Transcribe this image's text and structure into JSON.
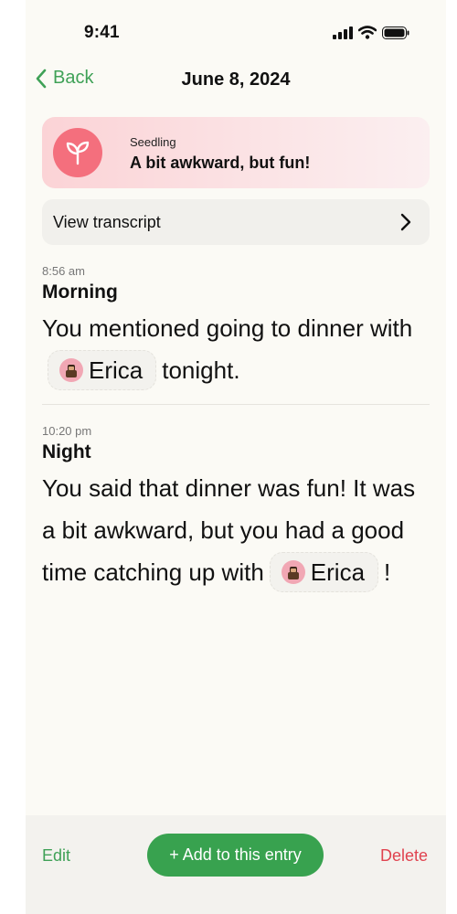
{
  "status_bar": {
    "time": "9:41",
    "icons": [
      "cellular-signal-icon",
      "wifi-icon",
      "battery-icon"
    ]
  },
  "nav": {
    "back_label": "Back",
    "title": "June 8, 2024"
  },
  "mood": {
    "kicker": "Seedling",
    "summary": "A bit awkward, but fun!",
    "icon": "sprout-icon"
  },
  "transcript": {
    "label": "View transcript"
  },
  "entries": [
    {
      "time": "8:56 am",
      "label": "Morning",
      "text_before": "You mentioned going to dinner with",
      "mention": "Erica",
      "text_after": "tonight."
    },
    {
      "time": "10:20 pm",
      "label": "Night",
      "text_before": "You said that dinner was fun! It was a bit awkward, but you had a good time catching up with",
      "mention": "Erica",
      "text_after": "!"
    }
  ],
  "actions": {
    "edit_label": "Edit",
    "add_label": "+ Add to this entry",
    "delete_label": "Delete"
  },
  "colors": {
    "accent_green": "#3fa157",
    "button_green": "#38a24f",
    "delete_red": "#e0434f",
    "mood_pink": "#f46f7d",
    "background": "#fbfaf5"
  }
}
